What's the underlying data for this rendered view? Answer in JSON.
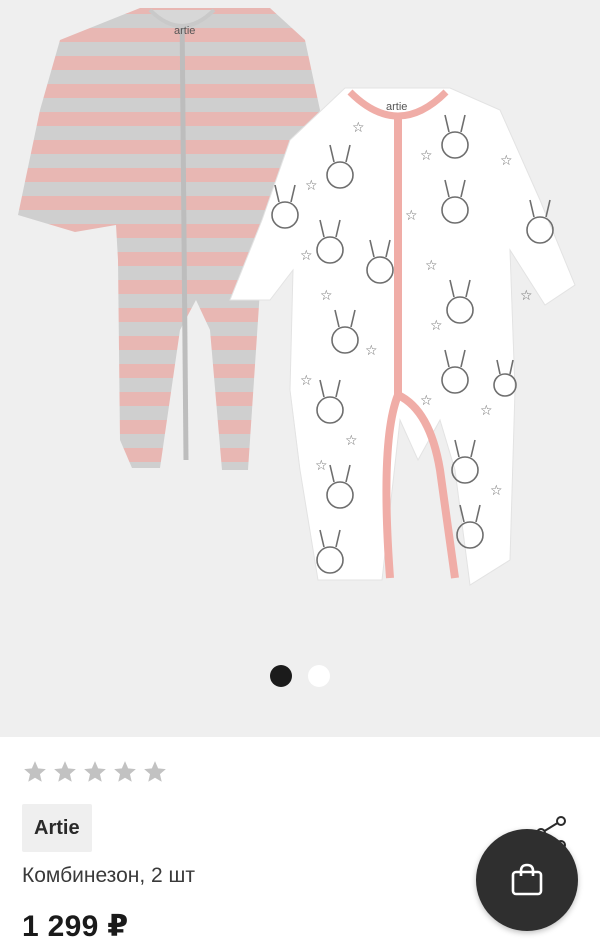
{
  "gallery": {
    "image_name": "product-photo",
    "slides_total": 2,
    "active_slide": 1
  },
  "product": {
    "rating_stars_total": 5,
    "rating_value": 0,
    "brand": "Artie",
    "title": "Комбинезон, 2 шт",
    "price": "1 299 ₽"
  },
  "colors": {
    "gallery_bg": "#efefef",
    "fab_bg": "#2f2f2f",
    "star_empty": "#c2c2c2",
    "dot_active": "#1b1b1b"
  },
  "icons": {
    "share": "share-icon",
    "cart": "shopping-bag-icon",
    "star": "star-icon"
  }
}
